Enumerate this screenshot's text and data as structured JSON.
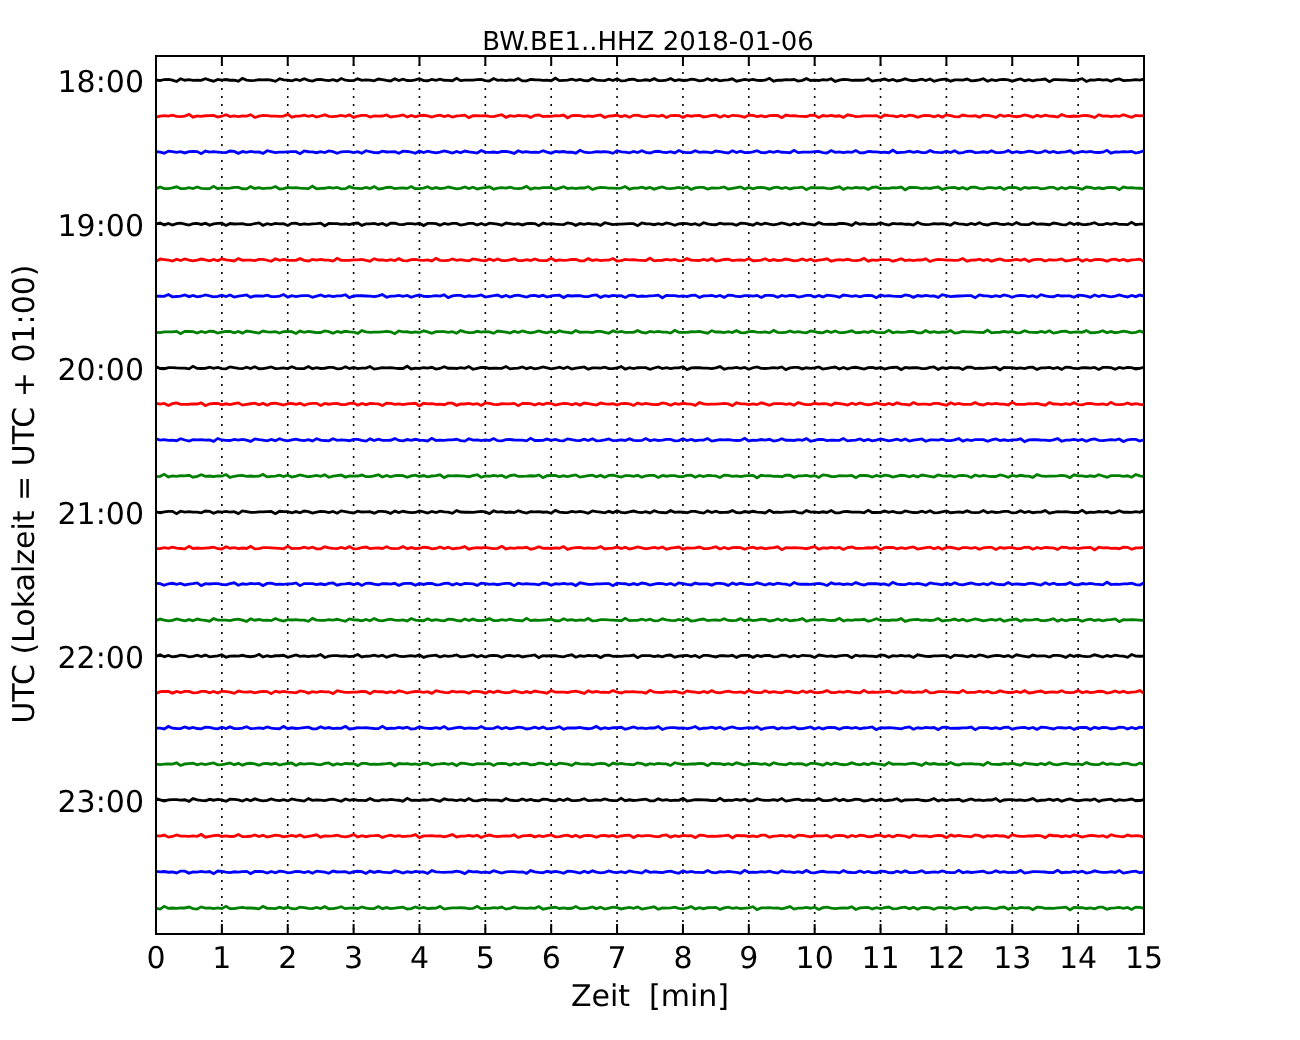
{
  "chart": {
    "title": "BW.BE1..HHZ 2018-01-06",
    "ylabel": "UTC (Lokalzeit = UTC + 01:00)",
    "xlabel": "Zeit  [min]",
    "xticks": [
      "0",
      "1",
      "2",
      "3",
      "4",
      "5",
      "6",
      "7",
      "8",
      "9",
      "10",
      "11",
      "12",
      "13",
      "14",
      "15"
    ],
    "hour_labels": [
      "18:00",
      "19:00",
      "20:00",
      "21:00",
      "22:00",
      "23:00"
    ],
    "traces": [
      {
        "color": "#000000"
      },
      {
        "color": "#ff0000"
      },
      {
        "color": "#0000ff"
      },
      {
        "color": "#008000"
      },
      {
        "color": "#000000"
      },
      {
        "color": "#ff0000"
      },
      {
        "color": "#0000ff"
      },
      {
        "color": "#008000"
      },
      {
        "color": "#000000"
      },
      {
        "color": "#ff0000"
      },
      {
        "color": "#0000ff"
      },
      {
        "color": "#008000"
      },
      {
        "color": "#000000"
      },
      {
        "color": "#ff0000"
      },
      {
        "color": "#0000ff"
      },
      {
        "color": "#008000"
      },
      {
        "color": "#000000"
      },
      {
        "color": "#ff0000"
      },
      {
        "color": "#0000ff"
      },
      {
        "color": "#008000"
      },
      {
        "color": "#000000"
      },
      {
        "color": "#ff0000"
      },
      {
        "color": "#0000ff"
      },
      {
        "color": "#008000"
      }
    ]
  }
}
